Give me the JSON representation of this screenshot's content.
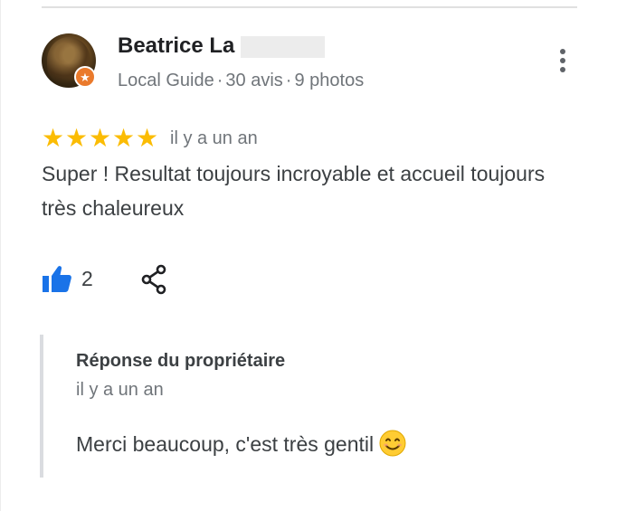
{
  "reviewer": {
    "name": "Beatrice La",
    "meta": {
      "role": "Local Guide",
      "reviews": "30 avis",
      "photos": "9 photos",
      "separator": "·"
    },
    "badge_icon": "star-badge-icon",
    "badge_glyph": "★"
  },
  "review": {
    "rating": 5,
    "star_glyph": "★",
    "time": "il y a un an",
    "text": "Super ! Resultat toujours incroyable et accueil toujours très chaleureux"
  },
  "actions": {
    "like_count": "2",
    "like_icon": "thumbs-up-icon",
    "share_icon": "share-icon",
    "more_icon": "more-vertical-icon"
  },
  "owner_reply": {
    "title": "Réponse du propriétaire",
    "time": "il y a un an",
    "text": "Merci beaucoup, c'est très gentil",
    "emoji_icon": "smiling-face-emoji-icon"
  },
  "colors": {
    "star": "#fbbc04",
    "like": "#1a73e8",
    "badge": "#ea7a2c",
    "secondary_text": "#70757a",
    "reply_border": "#dadce0"
  }
}
